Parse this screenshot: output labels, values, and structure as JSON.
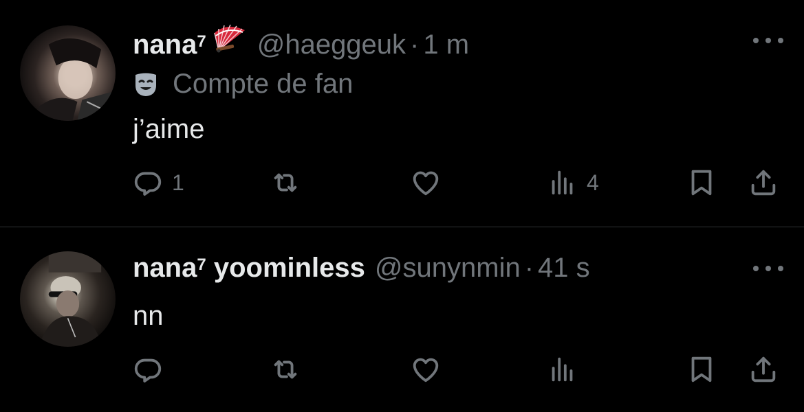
{
  "tweets": [
    {
      "display_name": "nana",
      "display_name_sup": "7",
      "name_emoji": "folding-fan-emoji",
      "handle": "@haeggeuk",
      "separator": "·",
      "time": "1 m",
      "label": "Compte de fan",
      "label_icon": "mask-icon",
      "text": "j’aime",
      "actions": {
        "reply_count": "1",
        "retweet_count": "",
        "like_count": "",
        "views_count": "4"
      }
    },
    {
      "display_name": "nana",
      "display_name_sup": "7",
      "display_name_rest": " yoominless",
      "handle": "@sunynmin",
      "separator": "·",
      "time": "41 s",
      "text": "nn",
      "actions": {
        "reply_count": "",
        "retweet_count": "",
        "like_count": "",
        "views_count": ""
      }
    }
  ],
  "colors": {
    "background": "#000000",
    "primary_text": "#e7e9ea",
    "secondary_text": "#71767b",
    "divider": "#2f3336"
  }
}
